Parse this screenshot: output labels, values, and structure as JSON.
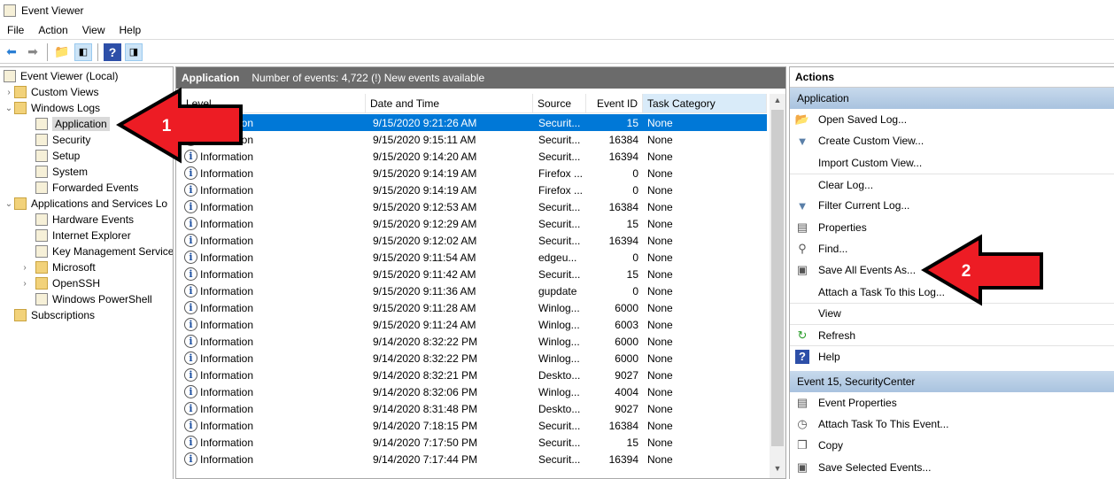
{
  "window": {
    "title": "Event Viewer"
  },
  "menu": [
    "File",
    "Action",
    "View",
    "Help"
  ],
  "tree": [
    {
      "label": "Event Viewer (Local)",
      "level": 0,
      "expander": ""
    },
    {
      "label": "Custom Views",
      "level": 1,
      "expander": ">"
    },
    {
      "label": "Windows Logs",
      "level": 1,
      "expander": "v"
    },
    {
      "label": "Application",
      "level": 2,
      "expander": "",
      "selected": true
    },
    {
      "label": "Security",
      "level": 2,
      "expander": ""
    },
    {
      "label": "Setup",
      "level": 2,
      "expander": ""
    },
    {
      "label": "System",
      "level": 2,
      "expander": ""
    },
    {
      "label": "Forwarded Events",
      "level": 2,
      "expander": ""
    },
    {
      "label": "Applications and Services Lo",
      "level": 1,
      "expander": "v"
    },
    {
      "label": "Hardware Events",
      "level": 2,
      "expander": ""
    },
    {
      "label": "Internet Explorer",
      "level": 2,
      "expander": ""
    },
    {
      "label": "Key Management Service",
      "level": 2,
      "expander": ""
    },
    {
      "label": "Microsoft",
      "level": 2,
      "expander": ">"
    },
    {
      "label": "OpenSSH",
      "level": 2,
      "expander": ">"
    },
    {
      "label": "Windows PowerShell",
      "level": 2,
      "expander": ""
    },
    {
      "label": "Subscriptions",
      "level": 1,
      "expander": ""
    }
  ],
  "log": {
    "name": "Application",
    "summary": "Number of events: 4,722 (!) New events available"
  },
  "columns": [
    "Level",
    "Date and Time",
    "Source",
    "Event ID",
    "Task Category"
  ],
  "events": [
    [
      "Information",
      "9/15/2020 9:21:26 AM",
      "Securit...",
      "15",
      "None"
    ],
    [
      "Information",
      "9/15/2020 9:15:11 AM",
      "Securit...",
      "16384",
      "None"
    ],
    [
      "Information",
      "9/15/2020 9:14:20 AM",
      "Securit...",
      "16394",
      "None"
    ],
    [
      "Information",
      "9/15/2020 9:14:19 AM",
      "Firefox ...",
      "0",
      "None"
    ],
    [
      "Information",
      "9/15/2020 9:14:19 AM",
      "Firefox ...",
      "0",
      "None"
    ],
    [
      "Information",
      "9/15/2020 9:12:53 AM",
      "Securit...",
      "16384",
      "None"
    ],
    [
      "Information",
      "9/15/2020 9:12:29 AM",
      "Securit...",
      "15",
      "None"
    ],
    [
      "Information",
      "9/15/2020 9:12:02 AM",
      "Securit...",
      "16394",
      "None"
    ],
    [
      "Information",
      "9/15/2020 9:11:54 AM",
      "edgeu...",
      "0",
      "None"
    ],
    [
      "Information",
      "9/15/2020 9:11:42 AM",
      "Securit...",
      "15",
      "None"
    ],
    [
      "Information",
      "9/15/2020 9:11:36 AM",
      "gupdate",
      "0",
      "None"
    ],
    [
      "Information",
      "9/15/2020 9:11:28 AM",
      "Winlog...",
      "6000",
      "None"
    ],
    [
      "Information",
      "9/15/2020 9:11:24 AM",
      "Winlog...",
      "6003",
      "None"
    ],
    [
      "Information",
      "9/14/2020 8:32:22 PM",
      "Winlog...",
      "6000",
      "None"
    ],
    [
      "Information",
      "9/14/2020 8:32:22 PM",
      "Winlog...",
      "6000",
      "None"
    ],
    [
      "Information",
      "9/14/2020 8:32:21 PM",
      "Deskto...",
      "9027",
      "None"
    ],
    [
      "Information",
      "9/14/2020 8:32:06 PM",
      "Winlog...",
      "4004",
      "None"
    ],
    [
      "Information",
      "9/14/2020 8:31:48 PM",
      "Deskto...",
      "9027",
      "None"
    ],
    [
      "Information",
      "9/14/2020 7:18:15 PM",
      "Securit...",
      "16384",
      "None"
    ],
    [
      "Information",
      "9/14/2020 7:17:50 PM",
      "Securit...",
      "15",
      "None"
    ],
    [
      "Information",
      "9/14/2020 7:17:44 PM",
      "Securit...",
      "16394",
      "None"
    ]
  ],
  "actions": {
    "title": "Actions",
    "sections": [
      {
        "title": "Application",
        "items": [
          {
            "label": "Open Saved Log...",
            "icon": "folder-open-icon",
            "glyph": "📂"
          },
          {
            "label": "Create Custom View...",
            "icon": "filter-icon",
            "glyph": "▼"
          },
          {
            "label": "Import Custom View...",
            "icon": "",
            "glyph": ""
          },
          {
            "label": "Clear Log...",
            "icon": "",
            "glyph": "",
            "sep": true
          },
          {
            "label": "Filter Current Log...",
            "icon": "filter-icon",
            "glyph": "▼"
          },
          {
            "label": "Properties",
            "icon": "properties-icon",
            "glyph": "▤"
          },
          {
            "label": "Find...",
            "icon": "binoculars-icon",
            "glyph": "⚲"
          },
          {
            "label": "Save All Events As...",
            "icon": "save-icon",
            "glyph": "▣"
          },
          {
            "label": "Attach a Task To this Log...",
            "icon": "",
            "glyph": ""
          },
          {
            "label": "View",
            "icon": "",
            "glyph": "",
            "sep": true
          },
          {
            "label": "Refresh",
            "icon": "refresh-icon",
            "glyph": "↻",
            "sep": true
          },
          {
            "label": "Help",
            "icon": "help-icon",
            "glyph": "?",
            "sep": true
          }
        ]
      },
      {
        "title": "Event 15, SecurityCenter",
        "items": [
          {
            "label": "Event Properties",
            "icon": "properties-icon",
            "glyph": "▤"
          },
          {
            "label": "Attach Task To This Event...",
            "icon": "clock-icon",
            "glyph": "◷"
          },
          {
            "label": "Copy",
            "icon": "copy-icon",
            "glyph": "❐"
          },
          {
            "label": "Save Selected Events...",
            "icon": "save-icon",
            "glyph": "▣"
          }
        ]
      }
    ]
  },
  "annotations": {
    "arrow1": "1",
    "arrow2": "2",
    "color": "#ed1c24"
  }
}
